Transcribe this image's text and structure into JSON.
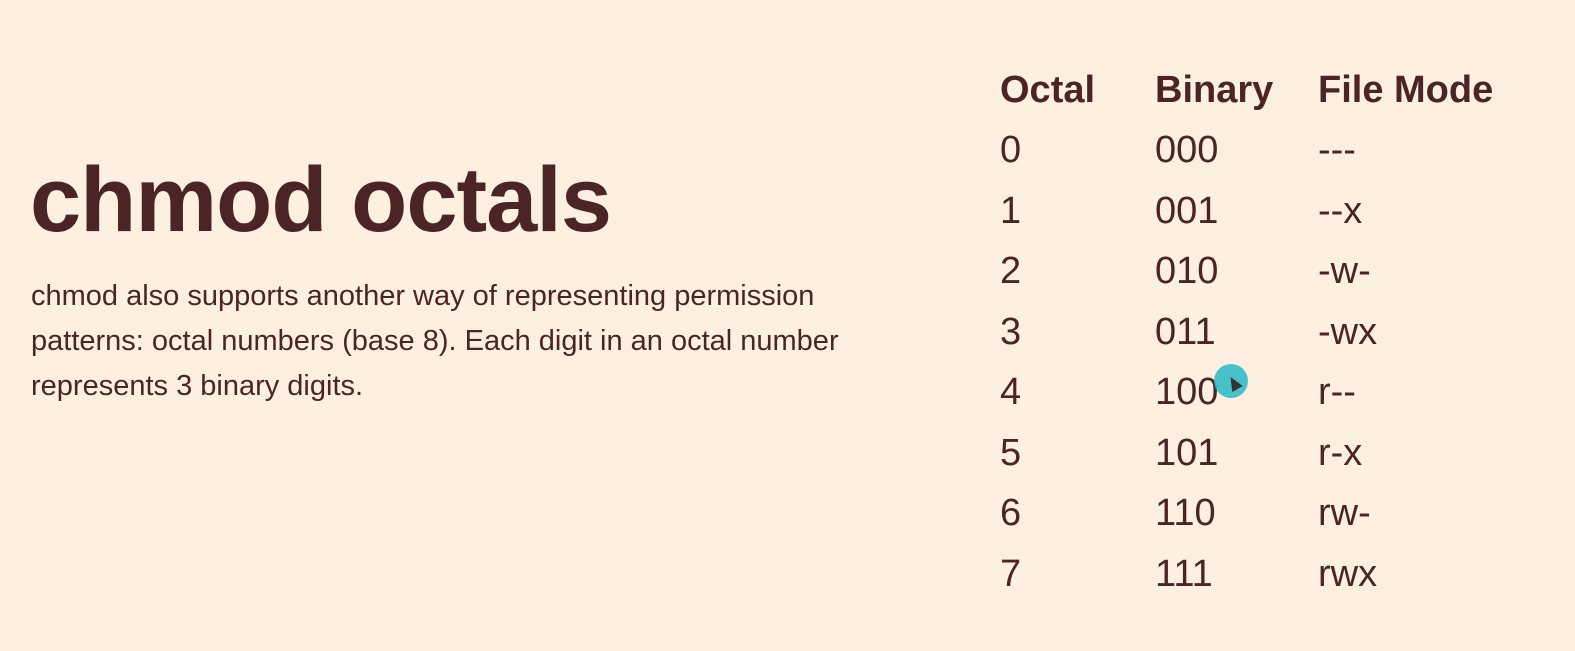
{
  "slide": {
    "title": "chmod octals",
    "description": "chmod also supports another way of representing permission patterns: octal numbers (base 8).  Each digit in an octal number represents 3 binary digits."
  },
  "table": {
    "headers": [
      "Octal",
      "Binary",
      "File Mode"
    ],
    "rows": [
      [
        "0",
        "000",
        "---"
      ],
      [
        "1",
        "001",
        "--x"
      ],
      [
        "2",
        "010",
        "-w-"
      ],
      [
        "3",
        "011",
        "-wx"
      ],
      [
        "4",
        "100",
        "r--"
      ],
      [
        "5",
        "101",
        "r-x"
      ],
      [
        "6",
        "110",
        "rw-"
      ],
      [
        "7",
        "111",
        "rwx"
      ]
    ]
  },
  "colors": {
    "background": "#fdf0e0",
    "text": "#4b2525",
    "cursor_highlight": "#28b9c8"
  }
}
